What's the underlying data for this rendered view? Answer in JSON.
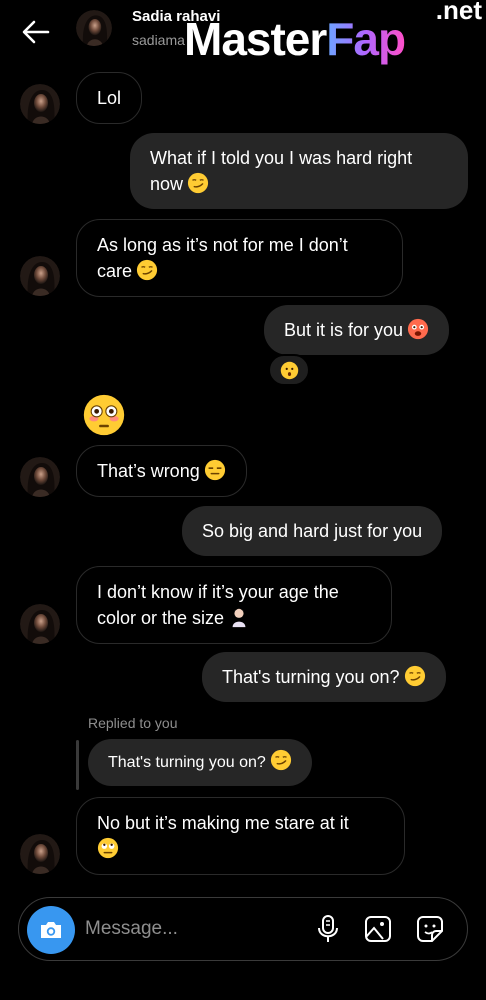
{
  "header": {
    "name": "Sadia rahavi",
    "username": "sadiama",
    "back_icon": "arrow-left-icon"
  },
  "watermark": {
    "main": "Master",
    "accent": "Fap",
    "suffix": ".net"
  },
  "messages": [
    {
      "side": "in",
      "text": "Lol",
      "emoji": ""
    },
    {
      "side": "out",
      "text": "What if I told you I was hard right now",
      "emoji": "smirk"
    },
    {
      "side": "in",
      "text": "As long as it’s not for me I don’t care",
      "emoji": "smirk"
    },
    {
      "side": "out",
      "text": "But it is for you",
      "emoji": "flushed-hot"
    },
    {
      "side": "in",
      "text": "That’s wrong",
      "emoji": "unamused"
    },
    {
      "side": "out",
      "text": "So big and hard just for you",
      "emoji": ""
    },
    {
      "side": "in",
      "text": "I don’t know if it’s your age the color or the size",
      "emoji": "facepalm"
    },
    {
      "side": "out",
      "text": "That's turning you on?",
      "emoji": "smirk"
    },
    {
      "side": "in",
      "text": "No but it’s making me stare at it",
      "emoji": "eye-roll"
    }
  ],
  "reaction": {
    "emoji": "hushed"
  },
  "standalone_emoji": "flushed",
  "reply": {
    "label": "Replied to you",
    "quoted_text": "That's turning you on?",
    "quoted_emoji": "smirk"
  },
  "composer": {
    "placeholder": "Message...",
    "camera_icon": "camera-icon",
    "mic_icon": "microphone-icon",
    "gallery_icon": "gallery-icon",
    "sticker_icon": "sticker-icon"
  },
  "colors": {
    "background": "#000000",
    "outgoing_bubble": "#262626",
    "incoming_border": "#2a2a2a",
    "camera_button": "#3897f0",
    "muted_text": "#8e8e8e"
  }
}
